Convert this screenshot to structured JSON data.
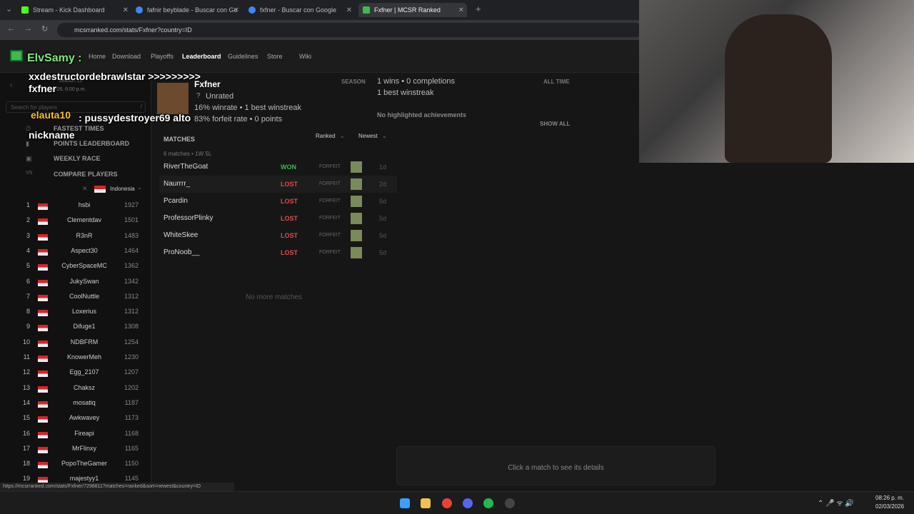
{
  "tabs": [
    {
      "title": "Stream - Kick Dashboard",
      "color": "#53fc18"
    },
    {
      "title": "fafnir beyblade - Buscar con Go",
      "color": "#4285f4"
    },
    {
      "title": "fxfner - Buscar con Google",
      "color": "#4285f4"
    },
    {
      "title": "Fxfner | MCSR Ranked",
      "color": "#3fb950"
    }
  ],
  "url": "mcsrranked.com/stats/Fxfner?country=ID",
  "site_nav": [
    "Home",
    "Download",
    "Playoffs",
    "Leaderboard",
    "Guidelines",
    "Store",
    "Wiki"
  ],
  "overlay": {
    "user1": "ElvSamy :",
    "msg1": "xxdestructordebrawlstar >>>>>>>>> fxfner",
    "user2": "elauta10",
    "msg2": ": pussydestroyer69 alto nickname"
  },
  "sidebar": {
    "season": "Season 10",
    "season_date": "01/05/26, 6:00 p.m.",
    "search_placeholder": "Search for players",
    "links": [
      "FASTEST TIMES",
      "POINTS LEADERBOARD",
      "WEEKLY RACE",
      "COMPARE PLAYERS"
    ],
    "country": "Indonesia",
    "leaderboard": [
      {
        "rank": "1",
        "name": "hsbi",
        "elo": "1927"
      },
      {
        "rank": "2",
        "name": "Clementdav",
        "elo": "1501"
      },
      {
        "rank": "3",
        "name": "R3nR",
        "elo": "1483"
      },
      {
        "rank": "4",
        "name": "Aspect30",
        "elo": "1464"
      },
      {
        "rank": "5",
        "name": "CyberSpaceMC",
        "elo": "1362"
      },
      {
        "rank": "6",
        "name": "JukySwan",
        "elo": "1342"
      },
      {
        "rank": "7",
        "name": "CoolNuttle",
        "elo": "1312"
      },
      {
        "rank": "8",
        "name": "Loxerius",
        "elo": "1312"
      },
      {
        "rank": "9",
        "name": "Difuge1",
        "elo": "1308"
      },
      {
        "rank": "10",
        "name": "NDBFRM",
        "elo": "1254"
      },
      {
        "rank": "11",
        "name": "KnowerMeh",
        "elo": "1230"
      },
      {
        "rank": "12",
        "name": "Egg_2107",
        "elo": "1207"
      },
      {
        "rank": "13",
        "name": "Chaksz",
        "elo": "1202"
      },
      {
        "rank": "14",
        "name": "mosatiq",
        "elo": "1187"
      },
      {
        "rank": "15",
        "name": "Awkwavey",
        "elo": "1173"
      },
      {
        "rank": "16",
        "name": "Fireapi",
        "elo": "1168"
      },
      {
        "rank": "17",
        "name": "MrFlinxy",
        "elo": "1165"
      },
      {
        "rank": "18",
        "name": "PopoTheGamer",
        "elo": "1150"
      },
      {
        "rank": "19",
        "name": "majestyy1",
        "elo": "1145"
      }
    ]
  },
  "profile": {
    "name": "Fxfner",
    "rank": "Unrated",
    "winrate_line": "16% winrate • 1 best winstreak",
    "forfeit_line": "83% forfeit rate • 0 points",
    "season_label": "SEASON",
    "alltime_label": "ALL TIME",
    "wins_line": "1 wins • 0 completions",
    "winstreak_line": "1 best winstreak",
    "achievements": "No highlighted achievements",
    "show_all": "SHOW ALL"
  },
  "matches": {
    "header": "MATCHES",
    "filter": "Ranked",
    "sort": "Newest",
    "summary": "6 matches • 1W 5L",
    "rows": [
      {
        "player": "RiverTheGoat",
        "result": "WON",
        "type": "FORFEIT",
        "age": "1d"
      },
      {
        "player": "Naurrrr_",
        "result": "LOST",
        "type": "FORFEIT",
        "age": "2d"
      },
      {
        "player": "Pcardin",
        "result": "LOST",
        "type": "FORFEIT",
        "age": "5d"
      },
      {
        "player": "ProfessorPlinky",
        "result": "LOST",
        "type": "FORFEIT",
        "age": "5d"
      },
      {
        "player": "WhiteSkee",
        "result": "LOST",
        "type": "FORFEIT",
        "age": "5d"
      },
      {
        "player": "ProNoob__",
        "result": "LOST",
        "type": "FORFEIT",
        "age": "5d"
      }
    ],
    "no_more": "No more matches",
    "detail_hint": "Click a match to see its details"
  },
  "status_url": "https://mcsrranked.com/stats/Fxfner/7298811?matches=ranked&sort=newest&country=ID",
  "clock": {
    "time": "08:26 p. m.",
    "date": "02/03/2026"
  },
  "colors": {
    "won": "#3fb950",
    "lost": "#e5484d"
  }
}
